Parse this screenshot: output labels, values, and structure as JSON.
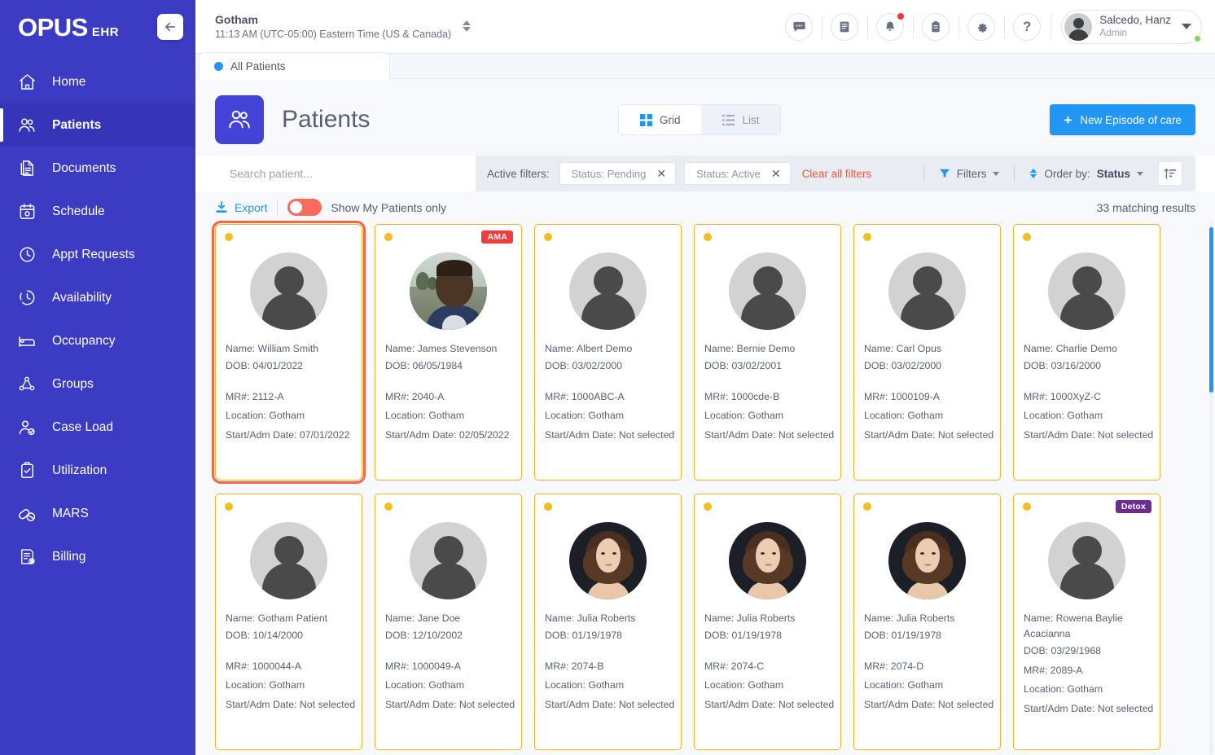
{
  "brand": {
    "name": "OPUS",
    "suffix": "EHR"
  },
  "sidebar": {
    "collapse_label": "collapse-sidebar",
    "items": [
      {
        "label": "Home",
        "icon": "home-icon"
      },
      {
        "label": "Patients",
        "icon": "patients-icon"
      },
      {
        "label": "Documents",
        "icon": "documents-icon"
      },
      {
        "label": "Schedule",
        "icon": "calendar-icon"
      },
      {
        "label": "Appt Requests",
        "icon": "clock-icon"
      },
      {
        "label": "Availability",
        "icon": "clock-dashed-icon"
      },
      {
        "label": "Occupancy",
        "icon": "bed-icon"
      },
      {
        "label": "Groups",
        "icon": "groups-icon"
      },
      {
        "label": "Case Load",
        "icon": "case-load-icon"
      },
      {
        "label": "Utilization",
        "icon": "clipboard-check-icon"
      },
      {
        "label": "MARS",
        "icon": "pills-icon"
      },
      {
        "label": "Billing",
        "icon": "billing-icon"
      }
    ],
    "active": "Patients"
  },
  "topbar": {
    "facility": "Gotham",
    "time": "11:13 AM (UTC-05:00) Eastern Time (US & Canada)",
    "icons": [
      {
        "name": "messages-icon",
        "glyph": "chat"
      },
      {
        "name": "notes-icon",
        "glyph": "book"
      },
      {
        "name": "notifications-icon",
        "glyph": "bell",
        "badge": true
      },
      {
        "name": "tasks-icon",
        "glyph": "clipboard"
      },
      {
        "name": "settings-icon",
        "glyph": "gear"
      },
      {
        "name": "help-icon",
        "glyph": "question"
      }
    ],
    "user": {
      "name": "Salcedo, Hanz",
      "role": "Admin"
    }
  },
  "tabs": [
    {
      "label": "All Patients",
      "active": true
    }
  ],
  "page": {
    "title": "Patients",
    "view_modes": [
      {
        "label": "Grid",
        "icon": "grid-icon",
        "active": true
      },
      {
        "label": "List",
        "icon": "list-icon",
        "active": false
      }
    ],
    "new_episode_label": "New Episode of care"
  },
  "filterbar": {
    "search_placeholder": "Search patient...",
    "search_value": "",
    "active_filters_label": "Active filters:",
    "chips": [
      "Status: Pending",
      "Status: Active"
    ],
    "clear_all_label": "Clear all filters",
    "filters_label": "Filters",
    "order_by_label": "Order by:",
    "order_by_value": "Status",
    "sort_icon": "sort-icon"
  },
  "actions": {
    "export_label": "Export",
    "toggle_label": "Show My Patients only",
    "toggle_on": true,
    "results_label": "33 matching results"
  },
  "labels": {
    "name": "Name:",
    "dob": "DOB:",
    "mr": "MR#:",
    "location": "Location:",
    "start": "Start/Adm Date:"
  },
  "patients": [
    {
      "name": "William Smith",
      "dob": "04/01/2022",
      "mr": "2112-A",
      "location": "Gotham",
      "start": "07/01/2022",
      "avatar": "placeholder",
      "tag": null,
      "selected": true
    },
    {
      "name": "James Stevenson",
      "dob": "06/05/1984",
      "mr": "2040-A",
      "location": "Gotham",
      "start": "02/05/2022",
      "avatar": "photo-man",
      "tag": "AMA",
      "selected": false
    },
    {
      "name": "Albert Demo",
      "dob": "03/02/2000",
      "mr": "1000ABC-A",
      "location": "Gotham",
      "start": "Not selected",
      "avatar": "placeholder",
      "tag": null,
      "selected": false
    },
    {
      "name": "Bernie Demo",
      "dob": "03/02/2001",
      "mr": "1000cde-B",
      "location": "Gotham",
      "start": "Not selected",
      "avatar": "placeholder",
      "tag": null,
      "selected": false
    },
    {
      "name": "Carl Opus",
      "dob": "03/02/2000",
      "mr": "1000109-A",
      "location": "Gotham",
      "start": "Not selected",
      "avatar": "placeholder",
      "tag": null,
      "selected": false
    },
    {
      "name": "Charlie Demo",
      "dob": "03/16/2000",
      "mr": "1000XyZ-C",
      "location": "Gotham",
      "start": "Not selected",
      "avatar": "placeholder",
      "tag": null,
      "selected": false
    },
    {
      "name": "Gotham Patient",
      "dob": "10/14/2000",
      "mr": "1000044-A",
      "location": "Gotham",
      "start": "Not selected",
      "avatar": "placeholder",
      "tag": null,
      "selected": false
    },
    {
      "name": "Jane Doe",
      "dob": "12/10/2002",
      "mr": "1000049-A",
      "location": "Gotham",
      "start": "Not selected",
      "avatar": "placeholder",
      "tag": null,
      "selected": false
    },
    {
      "name": "Julia Roberts",
      "dob": "01/19/1978",
      "mr": "2074-B",
      "location": "Gotham",
      "start": "Not selected",
      "avatar": "photo-woman",
      "tag": null,
      "selected": false
    },
    {
      "name": "Julia Roberts",
      "dob": "01/19/1978",
      "mr": "2074-C",
      "location": "Gotham",
      "start": "Not selected",
      "avatar": "photo-woman",
      "tag": null,
      "selected": false
    },
    {
      "name": "Julia Roberts",
      "dob": "01/19/1978",
      "mr": "2074-D",
      "location": "Gotham",
      "start": "Not selected",
      "avatar": "photo-woman",
      "tag": null,
      "selected": false
    },
    {
      "name": "Rowena Baylie Acacianna",
      "dob": "03/29/1968",
      "mr": "2089-A",
      "location": "Gotham",
      "start": "Not selected",
      "avatar": "placeholder",
      "tag": "Detox",
      "selected": false
    }
  ],
  "colors": {
    "sidebar": "#3b3bc4",
    "accent_blue": "#2196f3",
    "card_border": "#f0b323",
    "status_dot": "#f5bd21",
    "selected_outline": "#f4664a",
    "danger": "#f03e3e",
    "detox": "#6b2d8f",
    "toggle_on": "#fb6a5e",
    "clear_filters": "#f4563f"
  }
}
